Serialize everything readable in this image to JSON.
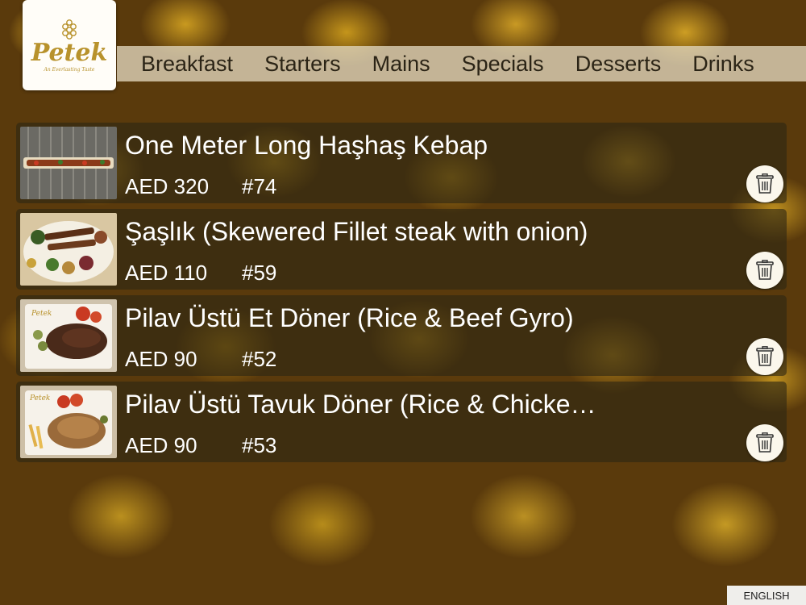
{
  "brand": {
    "name": "Petek",
    "tagline": "An Everlasting Taste"
  },
  "nav": {
    "items": [
      "Breakfast",
      "Starters",
      "Mains",
      "Specials",
      "Desserts",
      "Drinks"
    ]
  },
  "items": [
    {
      "title": "One Meter Long Haşhaş Kebap",
      "price": "AED 320",
      "number": "#74",
      "image": "kebab-board-photo"
    },
    {
      "title": "Şaşlık (Skewered Fillet steak with onion)",
      "price": "AED 110",
      "number": "#59",
      "image": "shashlik-platter-photo"
    },
    {
      "title": "Pilav Üstü Et Döner (Rice & Beef Gyro)",
      "price": "AED 90",
      "number": "#52",
      "image": "beef-doner-photo"
    },
    {
      "title": "Pilav Üstü Tavuk Döner (Rice & Chicke…",
      "price": "AED 90",
      "number": "#53",
      "image": "chicken-doner-photo"
    }
  ],
  "language": "ENGLISH",
  "colors": {
    "gold": "#b8922c",
    "nav_bg": "#e1d7be",
    "row_bg": "#2d2614"
  }
}
